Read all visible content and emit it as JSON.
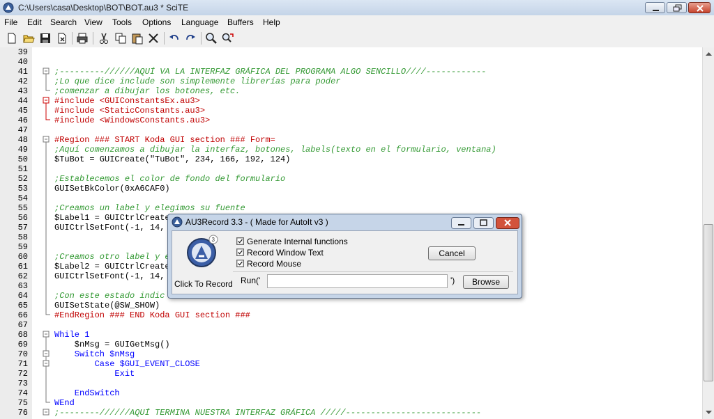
{
  "window": {
    "title": "C:\\Users\\casa\\Desktop\\BOT\\BOT.au3 * SciTE"
  },
  "menu": [
    "File",
    "Edit",
    "Search",
    "View",
    "Tools",
    "Options",
    "Language",
    "Buffers",
    "Help"
  ],
  "toolbar": [
    "new-icon",
    "open-icon",
    "save-icon",
    "close-file-icon",
    "print-icon",
    "cut-icon",
    "copy-icon",
    "paste-icon",
    "delete-icon",
    "undo-icon",
    "redo-icon",
    "find-icon",
    "replace-icon"
  ],
  "editor": {
    "lines": [
      {
        "n": "39",
        "t": "",
        "c": "plain"
      },
      {
        "n": "40",
        "t": "",
        "c": "plain"
      },
      {
        "n": "41",
        "t": ";---------//////AQUÍ VA LA INTERFAZ GRÁFICA DEL PROGRAMA ALGO SENCILLO////------------",
        "c": "comment"
      },
      {
        "n": "42",
        "t": ";Lo que dice include son simplemente librerías para poder",
        "c": "comment"
      },
      {
        "n": "43",
        "t": ";comenzar a dibujar los botones, etc.",
        "c": "comment"
      },
      {
        "n": "44",
        "t": "#include <GUIConstantsEx.au3>",
        "c": "inc"
      },
      {
        "n": "45",
        "t": "#include <StaticConstants.au3>",
        "c": "inc"
      },
      {
        "n": "46",
        "t": "#include <WindowsConstants.au3>",
        "c": "inc"
      },
      {
        "n": "47",
        "t": "",
        "c": "plain"
      },
      {
        "n": "48",
        "t": "#Region ### START Koda GUI section ### Form=",
        "c": "region"
      },
      {
        "n": "49",
        "t": ";Aquí comenzamos a dibujar la interfaz, botones, labels(texto en el formulario, ventana)",
        "c": "comment"
      },
      {
        "n": "50",
        "t": "$TuBot = GUICreate(\"TuBot\", 234, 166, 192, 124)",
        "c": "code"
      },
      {
        "n": "51",
        "t": "",
        "c": "plain"
      },
      {
        "n": "52",
        "t": ";Establecemos el color de fondo del formulario",
        "c": "comment"
      },
      {
        "n": "53",
        "t": "GUISetBkColor(0xA6CAF0)",
        "c": "code"
      },
      {
        "n": "54",
        "t": "",
        "c": "plain"
      },
      {
        "n": "55",
        "t": ";Creamos un label y elegimos su fuente",
        "c": "comment"
      },
      {
        "n": "56",
        "t": "$Label1 = GUICtrlCreate",
        "c": "code"
      },
      {
        "n": "57",
        "t": "GUICtrlSetFont(-1, 14,",
        "c": "code"
      },
      {
        "n": "58",
        "t": "",
        "c": "plain"
      },
      {
        "n": "59",
        "t": "",
        "c": "plain"
      },
      {
        "n": "60",
        "t": ";Creamos otro label y e",
        "c": "comment"
      },
      {
        "n": "61",
        "t": "$Label2 = GUICtrlCreate",
        "c": "code"
      },
      {
        "n": "62",
        "t": "GUICtrlSetFont(-1, 14,",
        "c": "code"
      },
      {
        "n": "63",
        "t": "",
        "c": "plain"
      },
      {
        "n": "64",
        "t": ";Con este estado indic",
        "c": "comment"
      },
      {
        "n": "65",
        "t": "GUISetState(@SW_SHOW)",
        "c": "code"
      },
      {
        "n": "66",
        "t": "#EndRegion ### END Koda GUI section ###",
        "c": "region"
      },
      {
        "n": "67",
        "t": "",
        "c": "plain"
      },
      {
        "n": "68",
        "t": "While 1",
        "c": "kw"
      },
      {
        "n": "69",
        "t": "    $nMsg = GUIGetMsg()",
        "c": "code"
      },
      {
        "n": "70",
        "t": "    Switch $nMsg",
        "c": "kw"
      },
      {
        "n": "71",
        "t": "        Case $GUI_EVENT_CLOSE",
        "c": "kw"
      },
      {
        "n": "72",
        "t": "            Exit",
        "c": "kw"
      },
      {
        "n": "73",
        "t": "",
        "c": "plain"
      },
      {
        "n": "74",
        "t": "    EndSwitch",
        "c": "kw"
      },
      {
        "n": "75",
        "t": "WEnd",
        "c": "kw"
      },
      {
        "n": "76",
        "t": ";--------//////AQUÍ TERMINA NUESTRA INTERFAZ GRÁFICA /////---------------------------",
        "c": "comment"
      }
    ]
  },
  "dialog": {
    "title": "AU3Record 3.3 - ( Made for AutoIt v3 )",
    "record_label": "Click To Record",
    "checkboxes": [
      {
        "label": "Generate Internal functions",
        "checked": true
      },
      {
        "label": "Record Window Text",
        "checked": true
      },
      {
        "label": "Record Mouse",
        "checked": true
      }
    ],
    "cancel_label": "Cancel",
    "run_prefix": "Run('",
    "run_suffix": "')",
    "run_value": "",
    "browse_label": "Browse"
  }
}
